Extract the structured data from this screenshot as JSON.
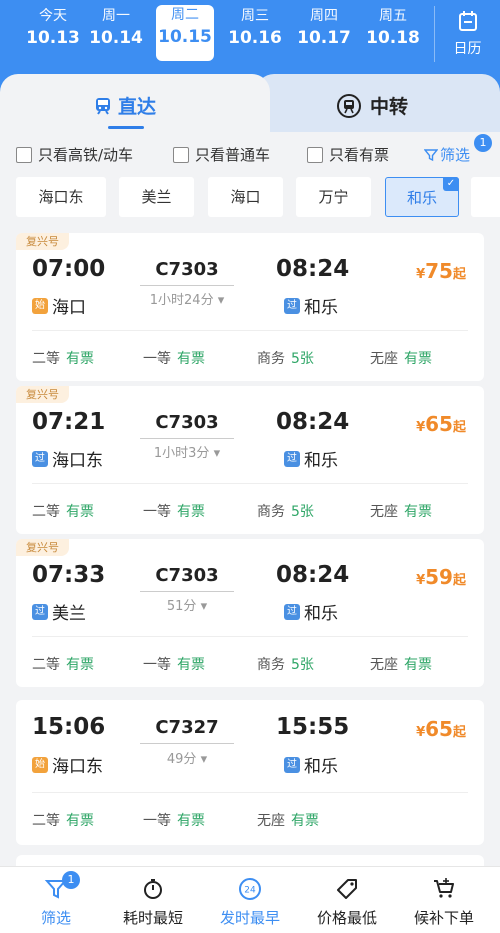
{
  "dates": [
    {
      "weekday": "今天",
      "date": "10.13"
    },
    {
      "weekday": "周一",
      "date": "10.14"
    },
    {
      "weekday": "周二",
      "date": "10.15"
    },
    {
      "weekday": "周三",
      "date": "10.16"
    },
    {
      "weekday": "周四",
      "date": "10.17"
    },
    {
      "weekday": "周五",
      "date": "10.18"
    }
  ],
  "calendar_label": "日历",
  "modes": {
    "direct": "直达",
    "transfer": "中转"
  },
  "filters": {
    "high_speed": "只看高铁/动车",
    "normal": "只看普通车",
    "available": "只看有票",
    "screen": "筛选",
    "screen_badge": "1"
  },
  "stations": [
    "海口东",
    "美兰",
    "海口",
    "万宁",
    "和乐"
  ],
  "trains": [
    {
      "tag": "复兴号",
      "dep_time": "07:00",
      "train_no": "C7303",
      "duration": "1小时24分",
      "arr_time": "08:24",
      "dep_station": "海口",
      "dep_mark": "始",
      "arr_station": "和乐",
      "arr_mark": "过",
      "price_currency": "¥",
      "price": "75",
      "price_suffix": "起",
      "seats": [
        {
          "class": "二等",
          "status": "有票"
        },
        {
          "class": "一等",
          "status": "有票"
        },
        {
          "class": "商务",
          "status": "5张"
        },
        {
          "class": "无座",
          "status": "有票"
        }
      ]
    },
    {
      "tag": "复兴号",
      "dep_time": "07:21",
      "train_no": "C7303",
      "duration": "1小时3分",
      "arr_time": "08:24",
      "dep_station": "海口东",
      "dep_mark": "过",
      "arr_station": "和乐",
      "arr_mark": "过",
      "price_currency": "¥",
      "price": "65",
      "price_suffix": "起",
      "seats": [
        {
          "class": "二等",
          "status": "有票"
        },
        {
          "class": "一等",
          "status": "有票"
        },
        {
          "class": "商务",
          "status": "5张"
        },
        {
          "class": "无座",
          "status": "有票"
        }
      ]
    },
    {
      "tag": "复兴号",
      "dep_time": "07:33",
      "train_no": "C7303",
      "duration": "51分",
      "arr_time": "08:24",
      "dep_station": "美兰",
      "dep_mark": "过",
      "arr_station": "和乐",
      "arr_mark": "过",
      "price_currency": "¥",
      "price": "59",
      "price_suffix": "起",
      "seats": [
        {
          "class": "二等",
          "status": "有票"
        },
        {
          "class": "一等",
          "status": "有票"
        },
        {
          "class": "商务",
          "status": "5张"
        },
        {
          "class": "无座",
          "status": "有票"
        }
      ]
    },
    {
      "tag": "",
      "dep_time": "15:06",
      "train_no": "C7327",
      "duration": "49分",
      "arr_time": "15:55",
      "dep_station": "海口东",
      "dep_mark": "始",
      "arr_station": "和乐",
      "arr_mark": "过",
      "price_currency": "¥",
      "price": "65",
      "price_suffix": "起",
      "seats": [
        {
          "class": "二等",
          "status": "有票"
        },
        {
          "class": "一等",
          "status": "有票"
        },
        {
          "class": "无座",
          "status": "有票"
        }
      ]
    }
  ],
  "bottom_nav": {
    "filter": "筛选",
    "filter_badge": "1",
    "shortest": "耗时最短",
    "earliest": "发时最早",
    "earliest_icon_text": "24",
    "cheapest": "价格最低",
    "waitlist": "候补下单"
  },
  "colors": {
    "primary": "#3d8ef2",
    "price": "#f08a2a",
    "available": "#2fa667"
  }
}
